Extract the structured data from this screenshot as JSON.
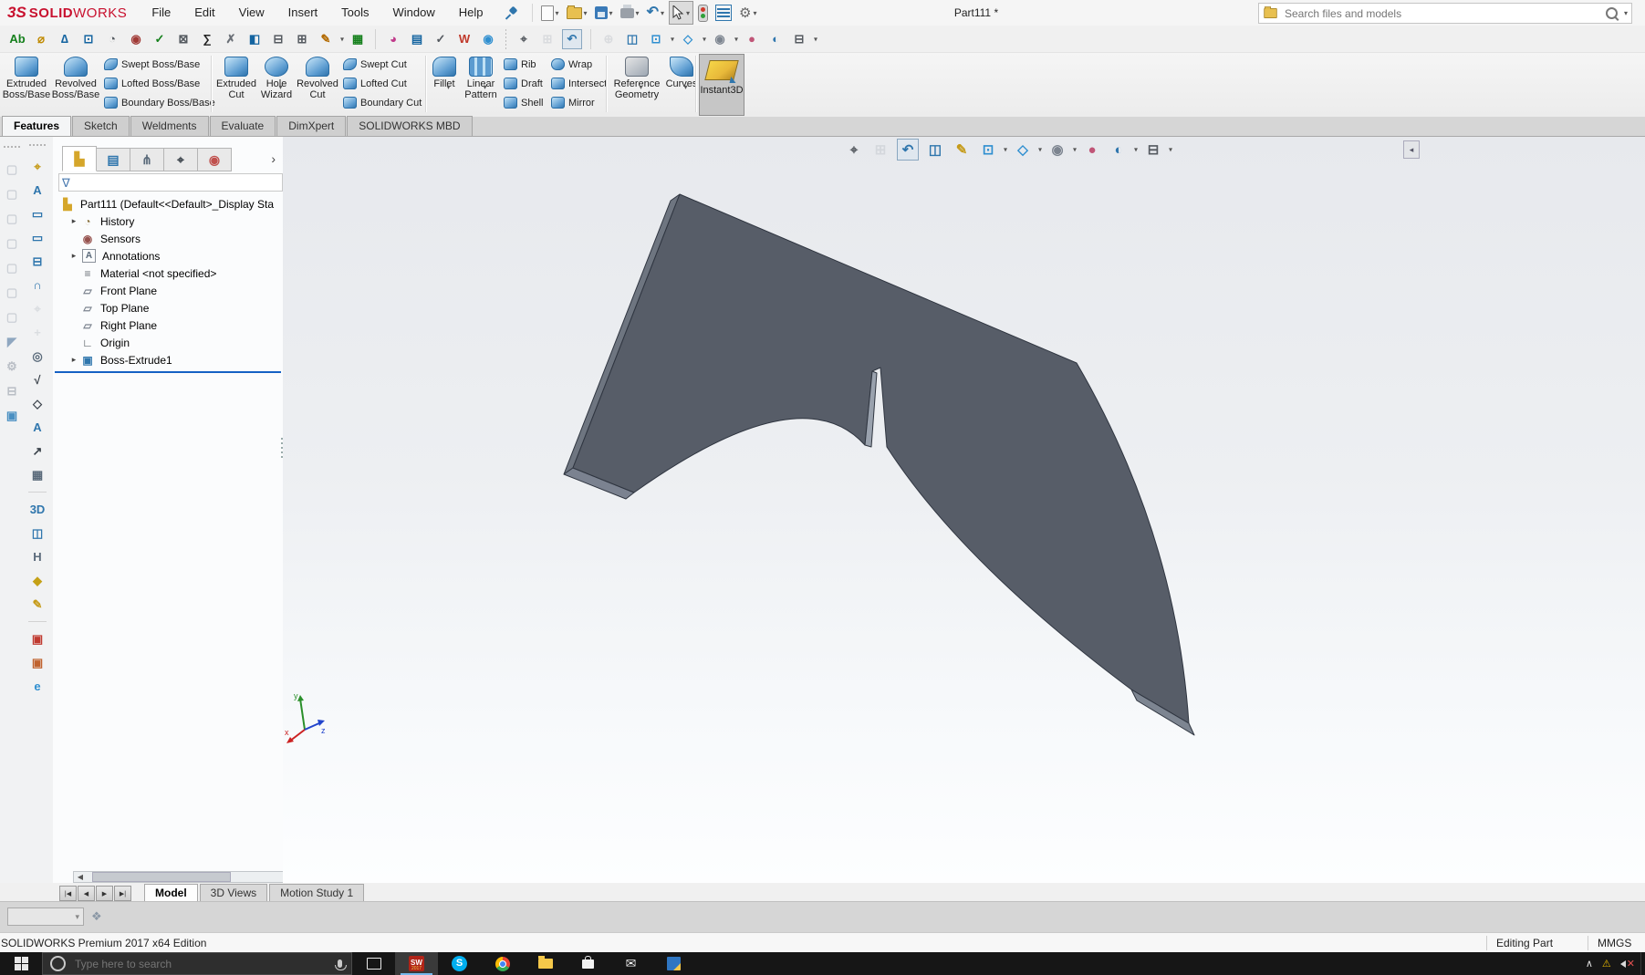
{
  "titlebar": {
    "logo": {
      "mark": "3S",
      "bold": "SOLID",
      "light": "WORKS"
    },
    "menus": [
      "File",
      "Edit",
      "View",
      "Insert",
      "Tools",
      "Window",
      "Help"
    ],
    "doc_title": "Part111 *",
    "search_placeholder": "Search files and models"
  },
  "quick_access": [
    "new-document",
    "open",
    "save",
    "print",
    "undo",
    "select-cursor",
    "rebuild",
    "file-properties",
    "options"
  ],
  "toolbar2": [
    {
      "n": "spell-checker",
      "g": "Ab",
      "c": "#15801c"
    },
    {
      "n": "measure",
      "g": "⌀",
      "c": "#c08a00"
    },
    {
      "n": "mass-properties",
      "g": "∆",
      "c": "#1464a0"
    },
    {
      "n": "section-properties",
      "g": "⊡",
      "c": "#1464a0"
    },
    {
      "n": "performance-evaluation",
      "g": "◔",
      "c": "#555a60"
    },
    {
      "n": "sensor",
      "g": "◉",
      "c": "#a03a36"
    },
    {
      "n": "check-entity",
      "g": "✓",
      "c": "#15801c"
    },
    {
      "n": "geometry-analysis",
      "g": "⊠",
      "c": "#555a60"
    },
    {
      "n": "equations",
      "g": "∑",
      "c": "#222222"
    },
    {
      "n": "deviation-analysis",
      "g": "✗",
      "c": "#6a6f76"
    },
    {
      "n": "draft-analysis",
      "g": "◧",
      "c": "#1464a0"
    },
    {
      "n": "thickness-analysis",
      "g": "⊟",
      "c": "#555a60"
    },
    {
      "n": "compare-documents",
      "g": "⊞",
      "c": "#555a60"
    },
    {
      "n": "import-diagnostics",
      "g": "✎",
      "c": "#b36a00",
      "dd": true
    },
    {
      "n": "design-table",
      "g": "▦",
      "c": "#15801c"
    },
    {
      "sep": true
    },
    {
      "n": "costing",
      "g": "◕",
      "c": "#c03a8a"
    },
    {
      "n": "design-checker",
      "g": "▤",
      "c": "#1464a0"
    },
    {
      "n": "check-active-document",
      "g": "✓",
      "c": "#555a60"
    },
    {
      "n": "word-export",
      "g": "W",
      "c": "#c0392b"
    },
    {
      "n": "edrawings",
      "g": "◉",
      "c": "#2f8fd0"
    },
    {
      "sep": true,
      "dotted": true
    },
    {
      "n": "zoom-to-fit",
      "g": "⌖",
      "c": "#555a60"
    },
    {
      "n": "zoom-to-area",
      "g": "⊞",
      "c": "#b9bec5",
      "disabled": true
    },
    {
      "n": "previous-view",
      "g": "↶",
      "c": "#2f76ad",
      "boxed": true
    },
    {
      "sep": true
    },
    {
      "n": "3d-drawing-view",
      "g": "⊕",
      "c": "#b9bec5",
      "disabled": true
    },
    {
      "n": "section-view",
      "g": "◫",
      "c": "#2f76ad"
    },
    {
      "n": "view-orientation",
      "g": "⊡",
      "c": "#2f8fd0",
      "dd": true
    },
    {
      "n": "display-style",
      "g": "◇",
      "c": "#2f8fd0",
      "dd": true
    },
    {
      "n": "hide-show-items",
      "g": "◉",
      "c": "#7d8590",
      "dd": true
    },
    {
      "n": "edit-appearance",
      "g": "●",
      "c": "#c05577"
    },
    {
      "n": "apply-scene",
      "g": "◐",
      "c": "#2f76ad"
    },
    {
      "n": "view-settings",
      "g": "⊟",
      "c": "#555a60",
      "dd": true
    }
  ],
  "ribbon": {
    "boss_big": [
      "Extruded Boss/Base",
      "Revolved Boss/Base"
    ],
    "boss_stack": [
      "Swept Boss/Base",
      "Lofted Boss/Base",
      "Boundary Boss/Base"
    ],
    "cut_big": [
      "Extruded Cut",
      "Hole Wizard",
      "Revolved Cut"
    ],
    "cut_stack": [
      "Swept Cut",
      "Lofted Cut",
      "Boundary Cut"
    ],
    "feat_big": [
      "Fillet",
      "Linear Pattern"
    ],
    "feat_stack1": [
      "Rib",
      "Draft",
      "Shell"
    ],
    "feat_stack2": [
      "Wrap",
      "Intersect",
      "Mirror"
    ],
    "ref_big": [
      "Reference Geometry",
      "Curves"
    ],
    "instant3d": "Instant3D"
  },
  "tabs": [
    {
      "label": "Features",
      "active": true
    },
    {
      "label": "Sketch"
    },
    {
      "label": "Weldments"
    },
    {
      "label": "Evaluate"
    },
    {
      "label": "DimXpert"
    },
    {
      "label": "SOLIDWORKS MBD"
    }
  ],
  "fm_tabs": [
    {
      "n": "featuremanager-design-tree-tab",
      "g": "▙",
      "c": "#d5a62a",
      "active": true
    },
    {
      "n": "propertymanager-tab",
      "g": "▤",
      "c": "#2f76ad"
    },
    {
      "n": "configurationmanager-tab",
      "g": "⋔",
      "c": "#5a6a7a"
    },
    {
      "n": "dimxpertmanager-tab",
      "g": "⌖",
      "c": "#3a424a"
    },
    {
      "n": "displaymanager-tab",
      "g": "◉",
      "c": "#c0504d"
    },
    {
      "n": "flyout-expand",
      "g": "›",
      "c": "#444444"
    }
  ],
  "feature_tree": {
    "filter_placeholder": "",
    "root_label": "Part111 (Default<<Default>_Display Sta",
    "items": [
      {
        "label": "History",
        "g": "◔",
        "c": "#8a7340",
        "expandable": true
      },
      {
        "label": "Sensors",
        "g": "◉",
        "c": "#96524e"
      },
      {
        "label": "Annotations",
        "g": "A",
        "c": "#5a6a7a",
        "expandable": true,
        "boxed": true
      },
      {
        "label": "Material <not specified>",
        "g": "≡",
        "c": "#6a6f76"
      },
      {
        "label": "Front Plane",
        "g": "▱",
        "c": "#7d8590"
      },
      {
        "label": "Top Plane",
        "g": "▱",
        "c": "#7d8590"
      },
      {
        "label": "Right Plane",
        "g": "▱",
        "c": "#7d8590"
      },
      {
        "label": "Origin",
        "g": "∟",
        "c": "#41484f"
      },
      {
        "label": "Boss-Extrude1",
        "g": "▣",
        "c": "#2f76ad",
        "expandable": true
      }
    ]
  },
  "ghost_toolbar": [
    {
      "n": "ghost-cube-1",
      "g": "▢",
      "c": "#ccd0d6"
    },
    {
      "n": "ghost-cube-2",
      "g": "▢",
      "c": "#ccd0d6"
    },
    {
      "n": "ghost-cube-3",
      "g": "▢",
      "c": "#ccd0d6"
    },
    {
      "n": "ghost-cube-4",
      "g": "▢",
      "c": "#ccd0d6"
    },
    {
      "n": "ghost-cube-5",
      "g": "▢",
      "c": "#ccd0d6"
    },
    {
      "n": "ghost-cube-6",
      "g": "▢",
      "c": "#ccd0d6"
    },
    {
      "n": "ghost-cube-7",
      "g": "▢",
      "c": "#ccd0d6"
    },
    {
      "n": "select-tool",
      "g": "◤",
      "c": "#8fa7c0"
    },
    {
      "n": "wrench-tool",
      "g": "⚙",
      "c": "#b9bec5"
    },
    {
      "n": "monitor-tool",
      "g": "⊟",
      "c": "#b9bec5"
    },
    {
      "n": "layers-tool",
      "g": "▣",
      "c": "#4a90c2"
    }
  ],
  "left_toolbar": [
    {
      "n": "smart-dimension",
      "g": "⌖",
      "c": "#c59a17"
    },
    {
      "n": "auto-dimension-scheme",
      "g": "A",
      "c": "#2f76ad"
    },
    {
      "n": "basic-size-dimension",
      "g": "▭",
      "c": "#2f76ad"
    },
    {
      "n": "basic-location-dimension",
      "g": "▭",
      "c": "#2f76ad"
    },
    {
      "n": "size-tolerance",
      "g": "⊟",
      "c": "#2f76ad"
    },
    {
      "n": "dual-dimension",
      "g": "∩",
      "c": "#2f76ad"
    },
    {
      "n": "datum",
      "g": "⌖",
      "c": "#b9bec5",
      "disabled": true
    },
    {
      "n": "show-tolerance-status",
      "g": "+",
      "c": "#b9bec5",
      "disabled": true
    },
    {
      "n": "find-annotation",
      "g": "◎",
      "c": "#5a6a7a"
    },
    {
      "n": "surface-finish",
      "g": "√",
      "c": "#3a424a"
    },
    {
      "n": "geometric-tolerance",
      "g": "◇",
      "c": "#3a424a"
    },
    {
      "n": "note",
      "g": "A",
      "c": "#2f76ad"
    },
    {
      "n": "multi-jog-leader",
      "g": "↗",
      "c": "#3a424a"
    },
    {
      "n": "general-table",
      "g": "▦",
      "c": "#5a6a7a"
    },
    {
      "sep": true
    },
    {
      "n": "3d-view-capture",
      "g": "3D",
      "c": "#2f76ad"
    },
    {
      "n": "section-view",
      "g": "◫",
      "c": "#2f76ad"
    },
    {
      "n": "break-view",
      "g": "H",
      "c": "#5a6a7a"
    },
    {
      "n": "part-pin-note",
      "g": "◆",
      "c": "#c5a117"
    },
    {
      "n": "edit-annotation",
      "g": "✎",
      "c": "#c59a17"
    },
    {
      "sep": true
    },
    {
      "n": "publish-pdf",
      "g": "▣",
      "c": "#c03a30"
    },
    {
      "n": "publish-step",
      "g": "▣",
      "c": "#c0632f"
    },
    {
      "n": "edrawings-publish",
      "g": "e",
      "c": "#2f8fd0"
    }
  ],
  "headsup": [
    {
      "n": "zoom-to-fit",
      "g": "⌖",
      "c": "#555a60"
    },
    {
      "n": "zoom-to-area",
      "g": "⊞",
      "c": "#b9bec5",
      "disabled": true
    },
    {
      "n": "previous-view",
      "g": "↶",
      "c": "#2f76ad",
      "boxed": true
    },
    {
      "n": "section-view",
      "g": "◫",
      "c": "#2f76ad"
    },
    {
      "n": "sketch-annotation",
      "g": "✎",
      "c": "#c59a17"
    },
    {
      "n": "view-orientation",
      "g": "⊡",
      "c": "#2f8fd0",
      "dd": true
    },
    {
      "n": "display-style",
      "g": "◇",
      "c": "#2f8fd0",
      "dd": true
    },
    {
      "n": "hide-show-items",
      "g": "◉",
      "c": "#7d8590",
      "dd": true
    },
    {
      "n": "edit-appearance",
      "g": "●",
      "c": "#c05577"
    },
    {
      "n": "apply-scene",
      "g": "◐",
      "c": "#2f76ad",
      "dd": true
    },
    {
      "n": "view-settings",
      "g": "⊟",
      "c": "#555a60",
      "dd": true
    }
  ],
  "viewport": {
    "part": {
      "face": "#575d68",
      "side_left": "#6e7580",
      "side_bottom": "#7b8290",
      "tip": "#7d8591",
      "slit": "#9aa2ae",
      "edge": "#2f3540"
    },
    "triad": {
      "x_color": "#cc2222",
      "y_color": "#2a8f2a",
      "z_color": "#2244cc",
      "x_label": "x",
      "y_label": "y",
      "z_label": "z"
    }
  },
  "sheet_nav": [
    "|◀",
    "◀",
    "▶",
    "▶|"
  ],
  "bottom_tabs": [
    {
      "label": "Model",
      "active": true
    },
    {
      "label": "3D Views"
    },
    {
      "label": "Motion Study 1"
    }
  ],
  "status_bar": {
    "left": "SOLIDWORKS Premium 2017 x64 Edition",
    "mode": "Editing Part",
    "units": "MMGS"
  },
  "taskbar": {
    "search_placeholder": "Type here to search",
    "apps": [
      {
        "n": "task-view"
      },
      {
        "n": "solidworks",
        "label": "SW",
        "sub": "2017",
        "active": true
      },
      {
        "n": "skype",
        "label": "S"
      },
      {
        "n": "chrome"
      },
      {
        "n": "file-explorer"
      },
      {
        "n": "microsoft-store"
      },
      {
        "n": "mail"
      },
      {
        "n": "photos"
      }
    ],
    "tray": [
      {
        "n": "hidden-icons-chevron",
        "g": "∧",
        "c": "#e0e0e0"
      },
      {
        "n": "network-warning",
        "g": "⚠",
        "c": "#e8b800"
      },
      {
        "n": "volume-muted",
        "g": "✕",
        "c": "#e05050",
        "speaker": true
      }
    ]
  }
}
